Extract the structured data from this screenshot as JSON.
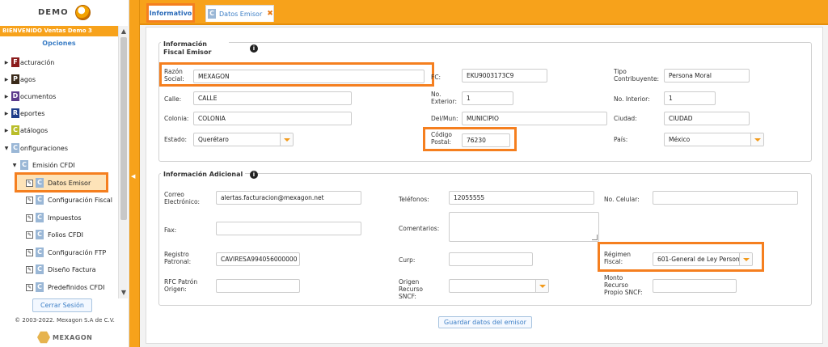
{
  "brand": {
    "name": "DEMO"
  },
  "sidebar": {
    "welcome": "BIENVENIDO Ventas Demo 3",
    "options_label": "Opciones",
    "menu": [
      {
        "badge": "F",
        "label": "acturación",
        "color": "#8b1c1c"
      },
      {
        "badge": "P",
        "label": "agos",
        "color": "#3a2a1a"
      },
      {
        "badge": "D",
        "label": "ocumentos",
        "color": "#5c3b8c"
      },
      {
        "badge": "R",
        "label": "eportes",
        "color": "#1f3d8a"
      },
      {
        "badge": "C",
        "label": "atálogos",
        "color": "#b9bd2a"
      },
      {
        "badge": "C",
        "label": "onfiguraciones",
        "color": "#9ab7d6"
      }
    ],
    "submenu_group": {
      "badge": "C",
      "label": "Emisión CFDI"
    },
    "submenu": [
      {
        "badge": "C",
        "label": "Datos Emisor"
      },
      {
        "badge": "C",
        "label": "Configuración Fiscal"
      },
      {
        "badge": "C",
        "label": "Impuestos"
      },
      {
        "badge": "C",
        "label": "Folios CFDI"
      },
      {
        "badge": "C",
        "label": "Configuración FTP"
      },
      {
        "badge": "C",
        "label": "Diseño Factura"
      },
      {
        "badge": "C",
        "label": "Predefinidos CFDI"
      }
    ],
    "logout_label": "Cerrar Sesión",
    "copyright": "© 2003-2022. Mexagon S.A de C.V.",
    "footer_logo": "MEXAGON"
  },
  "tabs": {
    "info_label": "Informativo",
    "emisor_badge": "C",
    "emisor_label": "Datos Emisor",
    "close_glyph": "✖"
  },
  "fiscal": {
    "legend": "Información Fiscal Emisor",
    "razon_social": {
      "label": "Razón Social:",
      "value": "MEXAGON"
    },
    "rfc": {
      "label": "FC:",
      "value": "EKU9003173C9"
    },
    "tipo": {
      "label": "Tipo Contribuyente:",
      "value": "Persona Moral"
    },
    "calle": {
      "label": "Calle:",
      "value": "CALLE"
    },
    "no_exterior": {
      "label": "No. Exterior:",
      "value": "1"
    },
    "no_interior": {
      "label": "No. Interior:",
      "value": "1"
    },
    "colonia": {
      "label": "Colonia:",
      "value": "COLONIA"
    },
    "delmun": {
      "label": "Del/Mun:",
      "value": "MUNICIPIO"
    },
    "ciudad": {
      "label": "Ciudad:",
      "value": "CIUDAD"
    },
    "estado": {
      "label": "Estado:",
      "value": "Querétaro"
    },
    "cp": {
      "label": "Código Postal:",
      "value": "76230"
    },
    "pais": {
      "label": "País:",
      "value": "México"
    }
  },
  "adicional": {
    "legend": "Información Adicional",
    "correo": {
      "label": "Correo Electrónico:",
      "value": "alertas.facturacion@mexagon.net"
    },
    "telefonos": {
      "label": "Teléfonos:",
      "value": "12055555"
    },
    "celular": {
      "label": "No. Celular:",
      "value": ""
    },
    "fax": {
      "label": "Fax:",
      "value": ""
    },
    "comentarios": {
      "label": "Comentarios:",
      "value": ""
    },
    "registro": {
      "label": "Registro Patronal:",
      "value": "CAVIRESA994056000000"
    },
    "curp": {
      "label": "Curp:",
      "value": ""
    },
    "regimen": {
      "label": "Régimen Fiscal:",
      "value": "601-General de Ley Person"
    },
    "rfc_patron": {
      "label": "RFC Patrón Origen:",
      "value": ""
    },
    "origen_recurso": {
      "label": "Origen Recurso SNCF:",
      "value": ""
    },
    "monto_recurso": {
      "label": "Monto Recurso Propio SNCF:",
      "value": ""
    }
  },
  "save_label": "Guardar datos del emisor"
}
